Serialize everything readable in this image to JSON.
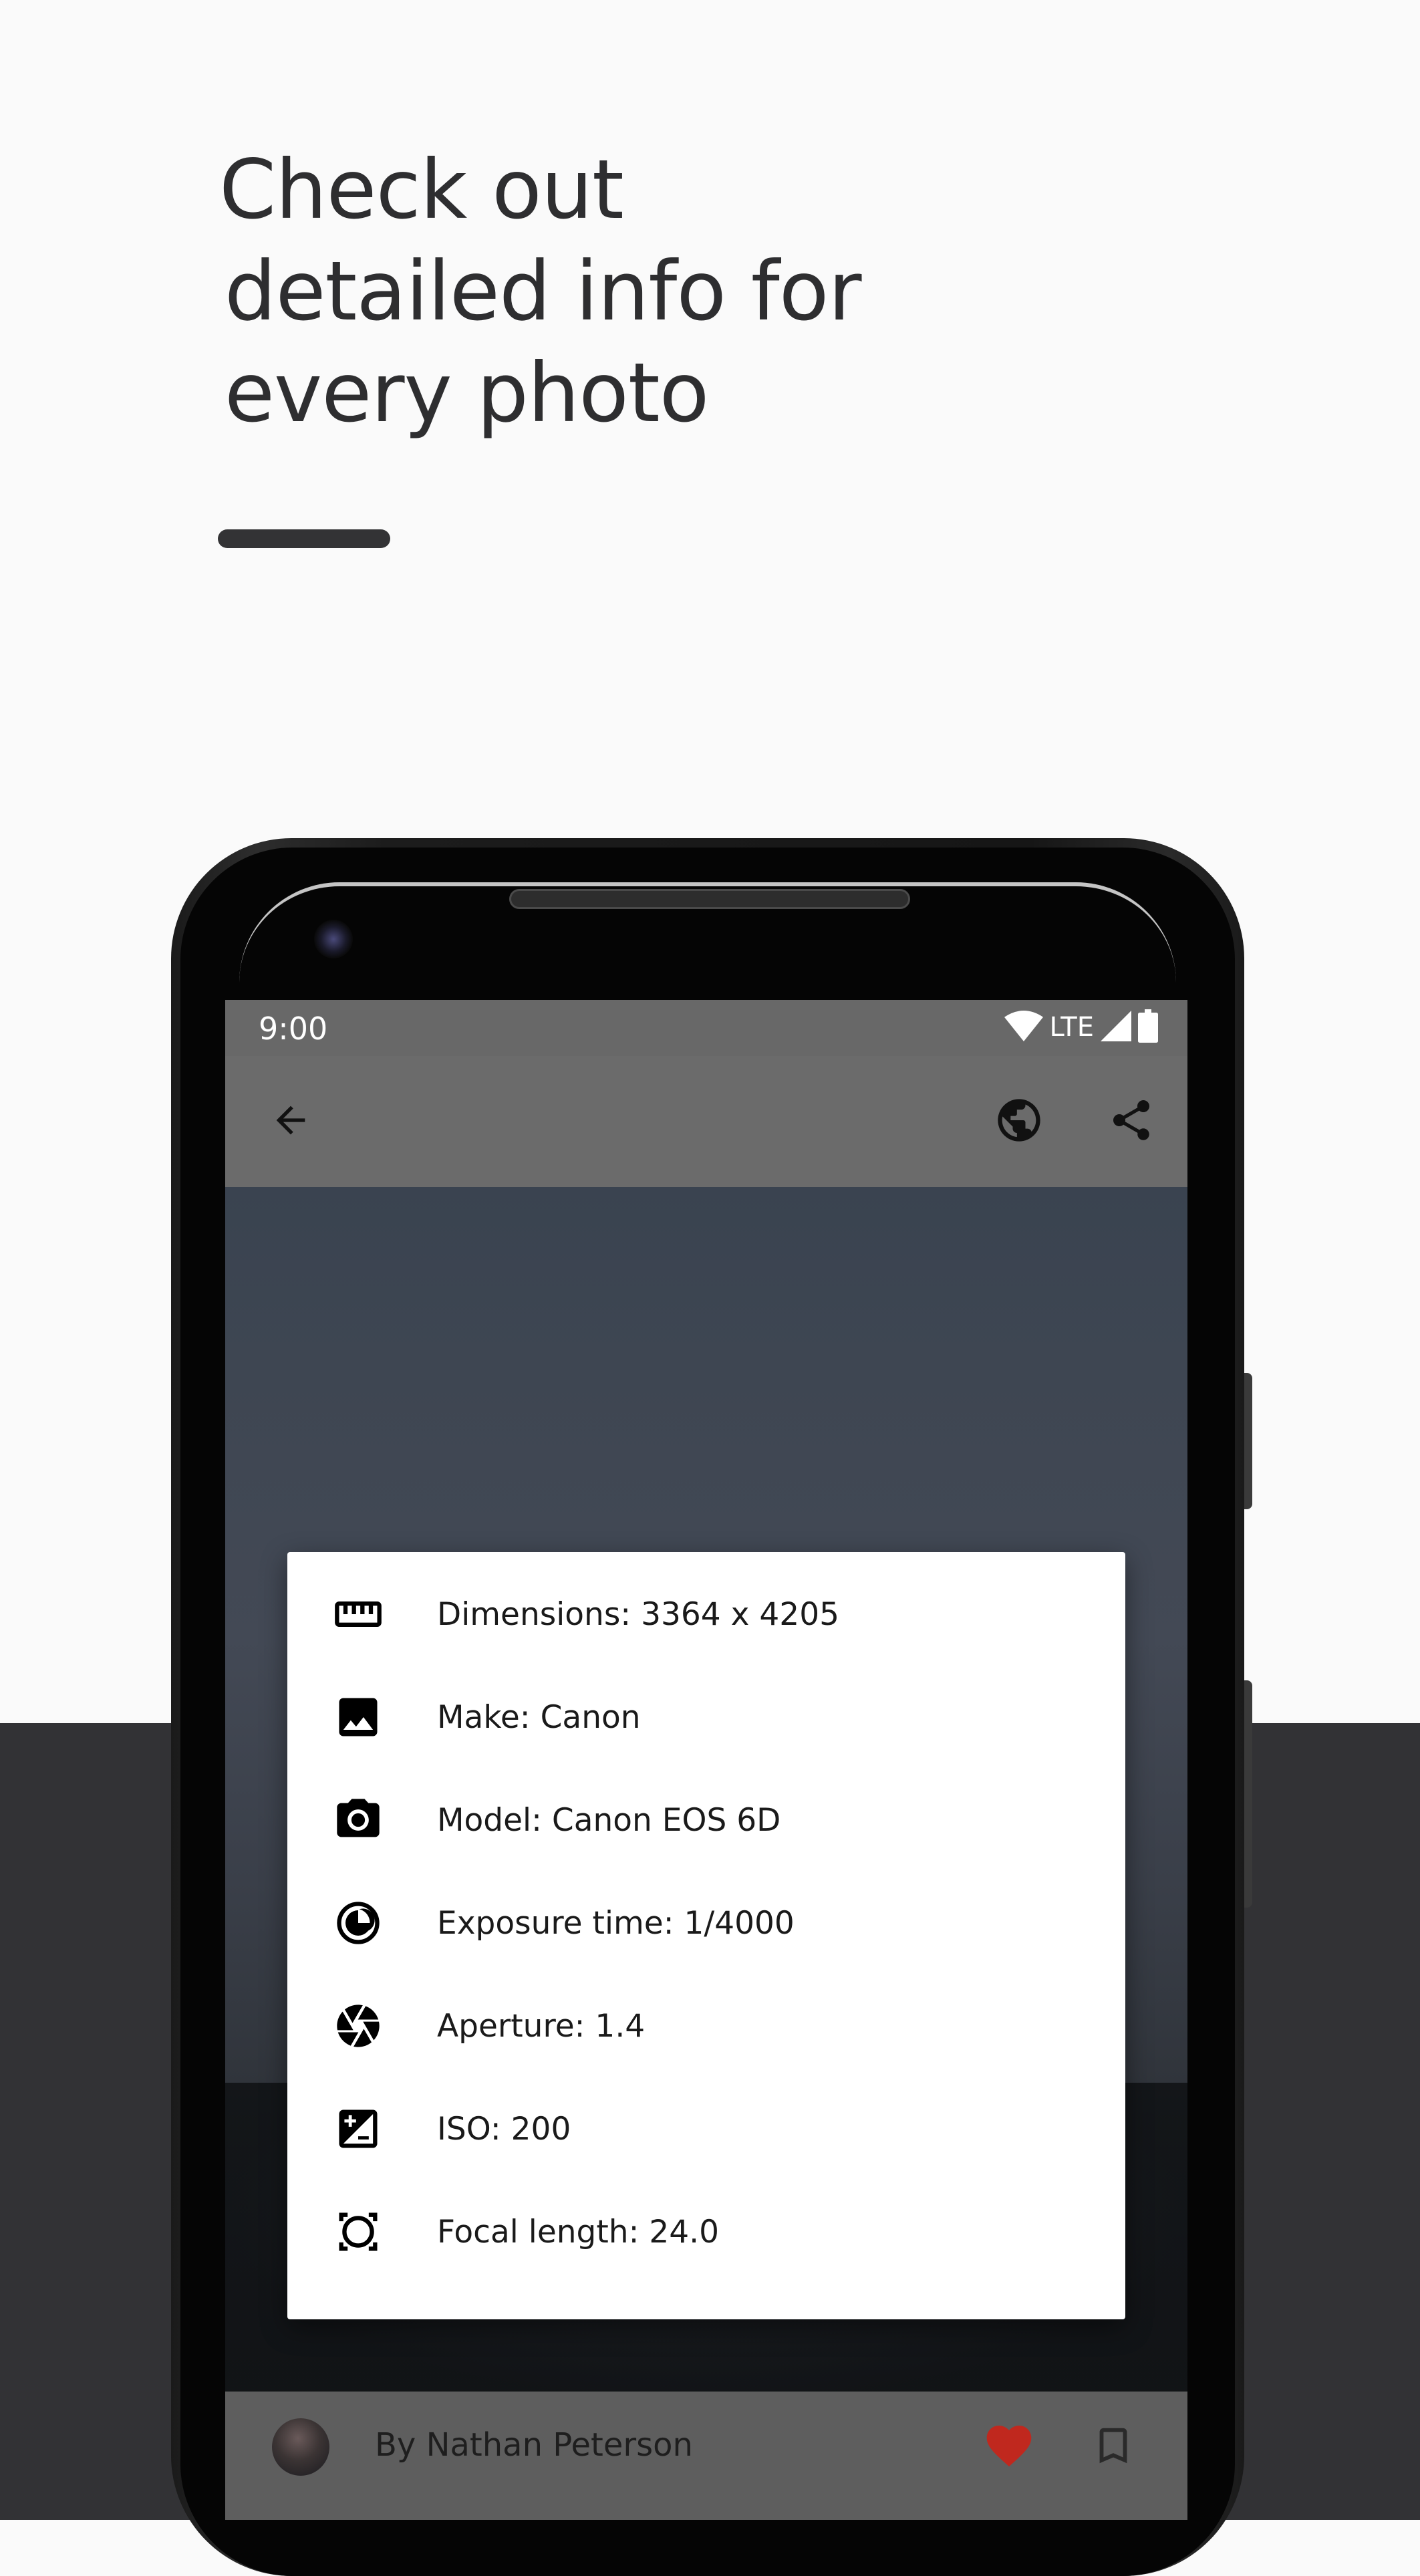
{
  "promo": {
    "headline_line1": "Check out",
    "headline_line2": "detailed info for",
    "headline_line3": "every photo"
  },
  "status_bar": {
    "time": "9:00",
    "network": "LTE"
  },
  "app_bar": {
    "back_icon": "arrow-back-icon",
    "globe_icon": "globe-icon",
    "share_icon": "share-icon"
  },
  "photo_info": {
    "items": [
      {
        "icon": "ruler-icon",
        "text": "Dimensions: 3364 x 4205"
      },
      {
        "icon": "image-icon",
        "text": "Make: Canon"
      },
      {
        "icon": "camera-icon",
        "text": "Model: Canon EOS 6D"
      },
      {
        "icon": "exposure-timer-icon",
        "text": "Exposure time: 1/4000"
      },
      {
        "icon": "aperture-icon",
        "text": "Aperture: 1.4"
      },
      {
        "icon": "iso-icon",
        "text": "ISO: 200"
      },
      {
        "icon": "focal-length-icon",
        "text": "Focal length: 24.0"
      }
    ]
  },
  "footer": {
    "author": "By Nathan Peterson",
    "like_icon": "heart-icon",
    "bookmark_icon": "bookmark-icon",
    "like_color": "#c0281e"
  },
  "colors": {
    "page_background": "#fafafa",
    "bottom_band": "#323235",
    "headline_text": "#2e2e30"
  }
}
